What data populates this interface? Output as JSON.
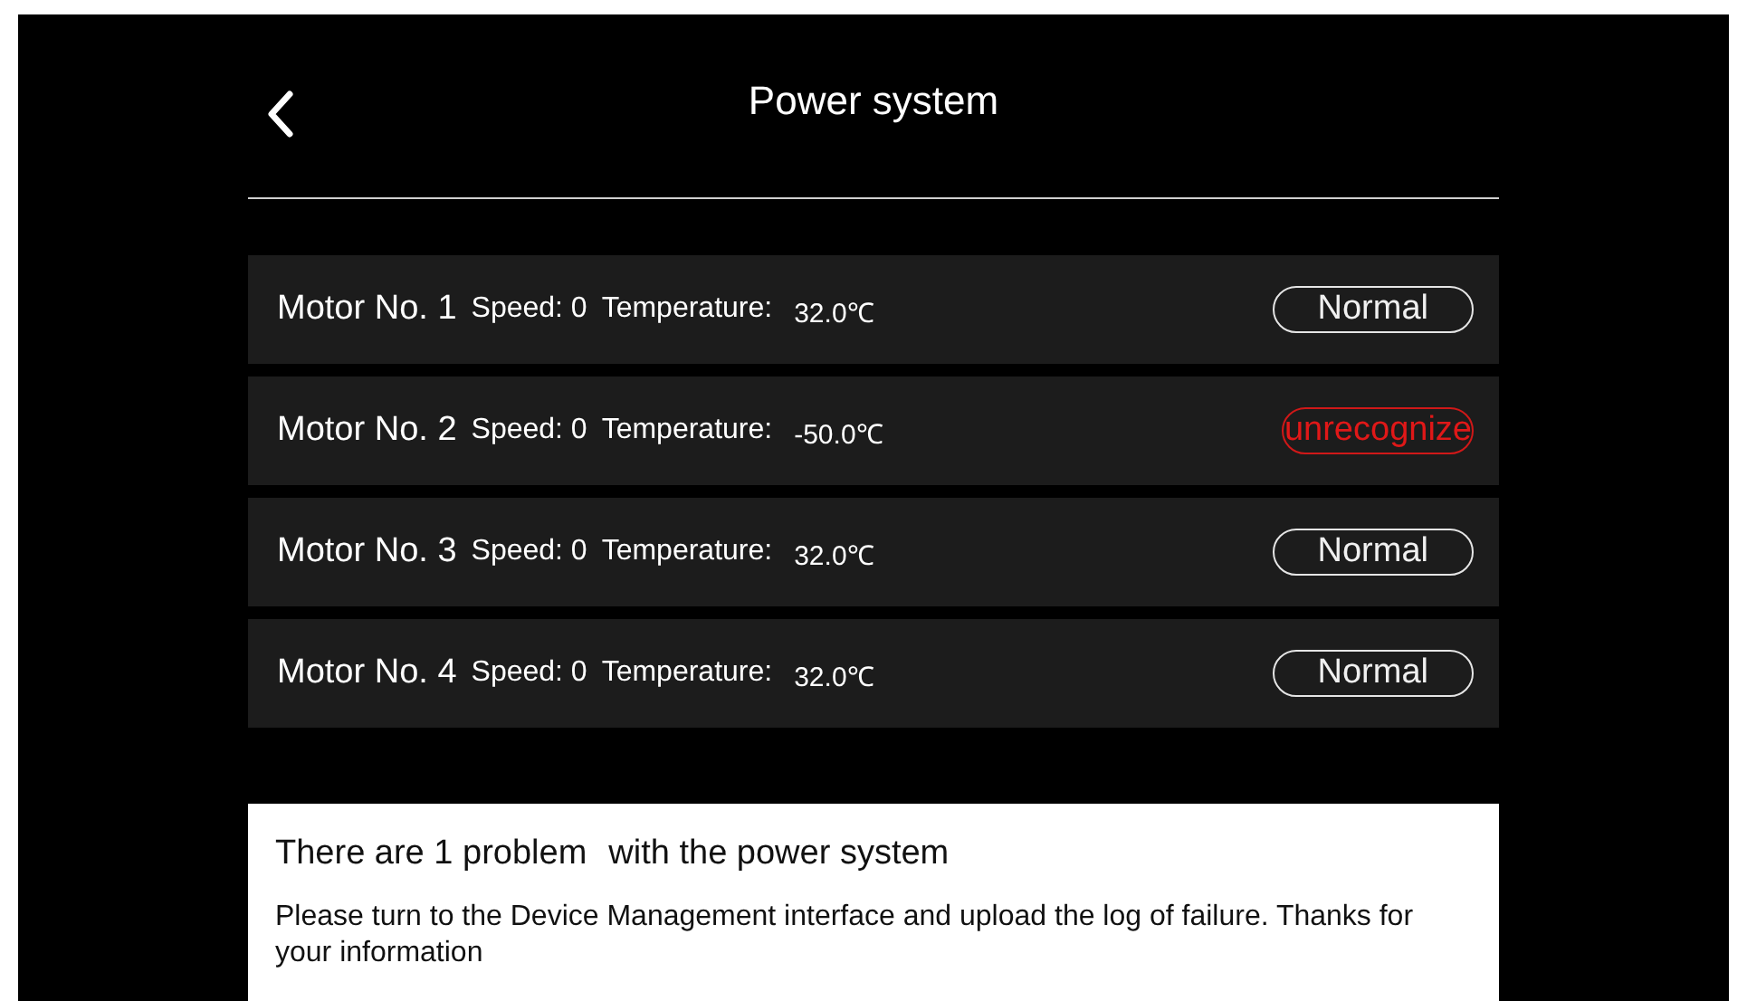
{
  "header": {
    "title": "Power system"
  },
  "motors": [
    {
      "name": "Motor No. 1",
      "speed": "Speed: 0",
      "temperature_label": "Temperature:",
      "temperature": "32.0℃",
      "status": {
        "kind": "normal",
        "label": "Normal"
      }
    },
    {
      "name": "Motor No. 2",
      "speed": "Speed: 0",
      "temperature_label": "Temperature:",
      "temperature": "-50.0℃",
      "status": {
        "kind": "error",
        "label": "unrecognize"
      }
    },
    {
      "name": "Motor No. 3",
      "speed": "Speed: 0",
      "temperature_label": "Temperature:",
      "temperature": "32.0℃",
      "status": {
        "kind": "normal",
        "label": "Normal"
      }
    },
    {
      "name": "Motor No. 4",
      "speed": "Speed: 0",
      "temperature_label": "Temperature:",
      "temperature": "32.0℃",
      "status": {
        "kind": "normal",
        "label": "Normal"
      }
    }
  ],
  "notice": {
    "summary": "There are 1 problem",
    "summary_suffix": "with the power system",
    "message": "Please turn to the Device Management interface and upload the log of failure. Thanks for your information"
  }
}
